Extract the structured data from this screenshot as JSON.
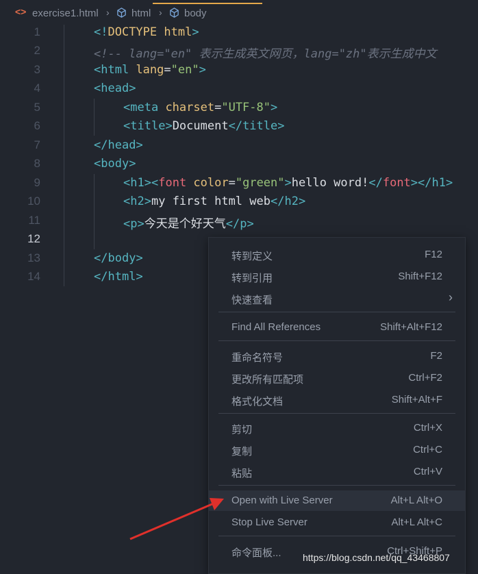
{
  "breadcrumb": {
    "file": "exercise1.html",
    "item1": "html",
    "item2": "body"
  },
  "editor": {
    "active_line": "12",
    "lines": [
      {
        "n": "1"
      },
      {
        "n": "2"
      },
      {
        "n": "3"
      },
      {
        "n": "4"
      },
      {
        "n": "5"
      },
      {
        "n": "6"
      },
      {
        "n": "7"
      },
      {
        "n": "8"
      },
      {
        "n": "9"
      },
      {
        "n": "10"
      },
      {
        "n": "11"
      },
      {
        "n": "12"
      },
      {
        "n": "13"
      },
      {
        "n": "14"
      }
    ],
    "tokens": {
      "l1": [
        "<!",
        "DOCTYPE",
        " html",
        ">"
      ],
      "l2": "<!-- lang=\"en\" 表示生成英文网页，lang=\"zh\"表示生成中文",
      "l3": [
        "<",
        "html",
        " lang",
        "=",
        "\"en\"",
        ">"
      ],
      "l4": [
        "<",
        "head",
        ">"
      ],
      "l5": [
        "<",
        "meta",
        " charset",
        "=",
        "\"UTF-8\"",
        ">"
      ],
      "l6": [
        "<",
        "title",
        ">",
        "Document",
        "</",
        "title",
        ">"
      ],
      "l7": [
        "</",
        "head",
        ">"
      ],
      "l8": [
        "<",
        "body",
        ">"
      ],
      "l9": [
        "<",
        "h1",
        ">",
        "<",
        "font",
        " color",
        "=",
        "\"green\"",
        ">",
        "hello word!",
        "</",
        "font",
        ">",
        "</",
        "h1",
        ">"
      ],
      "l10": [
        "<",
        "h2",
        ">",
        "my first html web",
        "</",
        "h2",
        ">"
      ],
      "l11": [
        "<",
        "p",
        ">",
        "今天是个好天气",
        "</",
        "p",
        ">"
      ],
      "l13": [
        "</",
        "body",
        ">"
      ],
      "l14": [
        "</",
        "html",
        ">"
      ]
    }
  },
  "context_menu": {
    "items": [
      {
        "label": "转到定义",
        "key": "F12"
      },
      {
        "label": "转到引用",
        "key": "Shift+F12"
      },
      {
        "label": "快速查看",
        "key": "›"
      },
      {
        "label": "Find All References",
        "key": "Shift+Alt+F12"
      },
      {
        "label": "重命名符号",
        "key": "F2"
      },
      {
        "label": "更改所有匹配项",
        "key": "Ctrl+F2"
      },
      {
        "label": "格式化文档",
        "key": "Shift+Alt+F"
      },
      {
        "label": "剪切",
        "key": "Ctrl+X"
      },
      {
        "label": "复制",
        "key": "Ctrl+C"
      },
      {
        "label": "粘贴",
        "key": "Ctrl+V"
      },
      {
        "label": "Open with Live Server",
        "key": "Alt+L Alt+O"
      },
      {
        "label": "Stop Live Server",
        "key": "Alt+L Alt+C"
      },
      {
        "label": "命令面板...",
        "key": "Ctrl+Shift+P"
      }
    ]
  },
  "watermark": "https://blog.csdn.net/qq_43468807",
  "colors": {
    "background": "#22262e",
    "tag": "#56b6c2",
    "tag_red": "#e86a78",
    "attr": "#e5c07b",
    "string": "#98c379",
    "arrow": "#e0302b"
  }
}
